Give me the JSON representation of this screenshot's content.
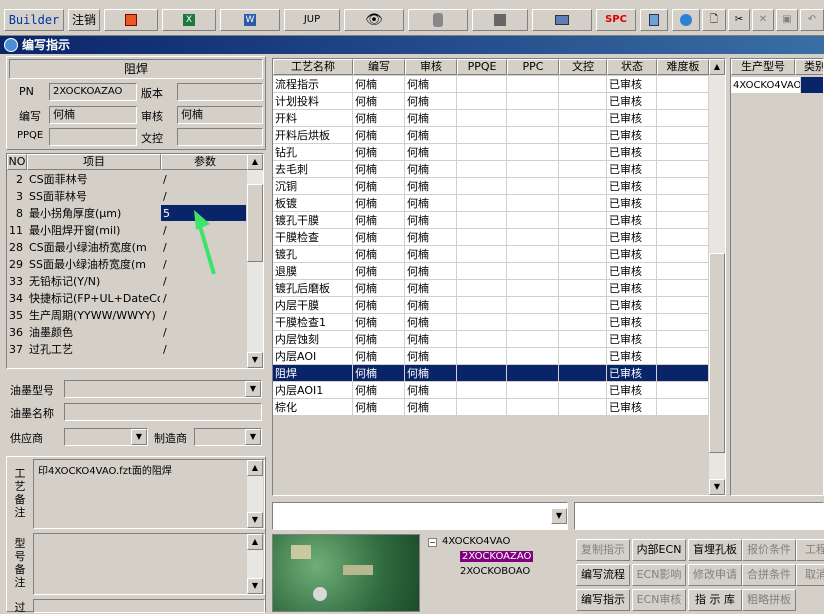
{
  "toolbar": {
    "builder": "Builder",
    "logout": "注销",
    "jup": "JUP",
    "spc": "SPC"
  },
  "window": {
    "title": "编写指示"
  },
  "left": {
    "section": "阻焊",
    "pn_label": "PN",
    "pn_value": "2XOCKOAZAO",
    "version_label": "版本",
    "version_value": "",
    "writer_label": "编写",
    "writer_value": "何楠",
    "reviewer_label": "审核",
    "reviewer_value": "何楠",
    "ppqe_label": "PPQE",
    "ppqe_value": "",
    "doc_control_label": "文控",
    "doc_control_value": ""
  },
  "param_table": {
    "headers": [
      "NO",
      "项目",
      "参数"
    ],
    "rows": [
      {
        "no": "2",
        "item": "CS面菲林号",
        "param": "/"
      },
      {
        "no": "3",
        "item": "SS面菲林号",
        "param": "/"
      },
      {
        "no": "8",
        "item": "最小拐角厚度(μm)",
        "param": "5"
      },
      {
        "no": "11",
        "item": "最小阻焊开窗(mil)",
        "param": "/"
      },
      {
        "no": "28",
        "item": "CS面最小绿油桥宽度(m",
        "param": "/"
      },
      {
        "no": "29",
        "item": "SS面最小绿油桥宽度(m",
        "param": "/"
      },
      {
        "no": "33",
        "item": "无铅标记(Y/N)",
        "param": "/"
      },
      {
        "no": "34",
        "item": "快捷标记(FP+UL+DateCo",
        "param": "/"
      },
      {
        "no": "35",
        "item": "生产周期(YYWW/WWYY)",
        "param": "/"
      },
      {
        "no": "36",
        "item": "油墨颜色",
        "param": "/"
      },
      {
        "no": "37",
        "item": "过孔工艺",
        "param": "/"
      }
    ]
  },
  "ink": {
    "type_label": "油墨型号",
    "name_label": "油墨名称",
    "supplier_label": "供应商",
    "maker_label": "制造商"
  },
  "notes": {
    "process_label": "工艺备注",
    "process_text": "印4XOCKO4VAO.fzt面的阻焊",
    "model_label": "型号备注",
    "last_label": "过"
  },
  "process_table": {
    "headers": [
      "工艺名称",
      "编写",
      "审核",
      "PPQE",
      "PPC",
      "文控",
      "状态",
      "难度板"
    ],
    "rows": [
      {
        "name": "流程指示",
        "writer": "何楠",
        "reviewer": "何楠",
        "status": "已审核"
      },
      {
        "name": "计划投料",
        "writer": "何楠",
        "reviewer": "何楠",
        "status": "已审核"
      },
      {
        "name": "开料",
        "writer": "何楠",
        "reviewer": "何楠",
        "status": "已审核"
      },
      {
        "name": "开料后烘板",
        "writer": "何楠",
        "reviewer": "何楠",
        "status": "已审核"
      },
      {
        "name": "钻孔",
        "writer": "何楠",
        "reviewer": "何楠",
        "status": "已审核"
      },
      {
        "name": "去毛刺",
        "writer": "何楠",
        "reviewer": "何楠",
        "status": "已审核"
      },
      {
        "name": "沉铜",
        "writer": "何楠",
        "reviewer": "何楠",
        "status": "已审核"
      },
      {
        "name": "板镀",
        "writer": "何楠",
        "reviewer": "何楠",
        "status": "已审核"
      },
      {
        "name": "镀孔干膜",
        "writer": "何楠",
        "reviewer": "何楠",
        "status": "已审核"
      },
      {
        "name": "干膜检查",
        "writer": "何楠",
        "reviewer": "何楠",
        "status": "已审核"
      },
      {
        "name": "镀孔",
        "writer": "何楠",
        "reviewer": "何楠",
        "status": "已审核"
      },
      {
        "name": "退膜",
        "writer": "何楠",
        "reviewer": "何楠",
        "status": "已审核"
      },
      {
        "name": "镀孔后磨板",
        "writer": "何楠",
        "reviewer": "何楠",
        "status": "已审核"
      },
      {
        "name": "内层干膜",
        "writer": "何楠",
        "reviewer": "何楠",
        "status": "已审核"
      },
      {
        "name": "干膜检查1",
        "writer": "何楠",
        "reviewer": "何楠",
        "status": "已审核"
      },
      {
        "name": "内层蚀刻",
        "writer": "何楠",
        "reviewer": "何楠",
        "status": "已审核"
      },
      {
        "name": "内层AOI",
        "writer": "何楠",
        "reviewer": "何楠",
        "status": "已审核"
      },
      {
        "name": "阻焊",
        "writer": "何楠",
        "reviewer": "何楠",
        "status": "已审核"
      },
      {
        "name": "内层AOI1",
        "writer": "何楠",
        "reviewer": "何楠",
        "status": "已审核"
      },
      {
        "name": "棕化",
        "writer": "何楠",
        "reviewer": "何楠",
        "status": "已审核"
      }
    ]
  },
  "model_table": {
    "headers": [
      "生产型号",
      "类别"
    ],
    "rows": [
      {
        "model": "4XOCKO4VAO"
      }
    ]
  },
  "tree": {
    "root": "4XOCKO4VAO",
    "child1": "2XOCKOAZAO",
    "child2": "2XOCKOBOAO"
  },
  "actions": {
    "col1": [
      "复制指示",
      "编写流程",
      "编写指示"
    ],
    "col2": [
      "内部ECN",
      "ECN影响",
      "ECN审核"
    ],
    "col3": [
      "盲埋孔板",
      "修改申请",
      "指 示 库"
    ],
    "col4": [
      "报价条件",
      "合拼条件",
      "粗略拼板"
    ],
    "col5": [
      "工程",
      "取消"
    ]
  }
}
